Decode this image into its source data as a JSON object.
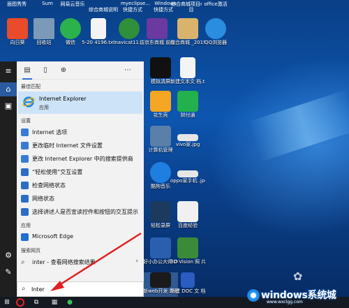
{
  "top_labels": [
    "面图秀秀",
    "Sum",
    "网易云音乐",
    "myeclipse...",
    "Windows",
    "综合商城项目rar",
    "office激活"
  ],
  "top_labels_mid": [
    "综合商城说明",
    "快捷方式",
    "快捷方式",
    "目"
  ],
  "desktop_icons_row1": [
    {
      "label": "向日葵",
      "icon": "sunflower-icon",
      "color": "#e94b2b"
    },
    {
      "label": "回收站",
      "icon": "recycle-bin-icon",
      "color": "#7a9ab8"
    },
    {
      "label": "微信",
      "icon": "wechat-icon",
      "color": "#2bb24c"
    },
    {
      "label": "5-20\n4196.txt",
      "icon": "text-file-icon",
      "color": "#f4f4f4"
    },
    {
      "label": "navicat11...",
      "icon": "navicat-icon",
      "color": "#2f8f3a"
    },
    {
      "label": "仿京东商城\n前台代码",
      "icon": "rar-icon",
      "color": "#6a3aa0"
    },
    {
      "label": "综合商城\n_2019082...",
      "icon": "avatar-icon",
      "color": "#d9b36c"
    },
    {
      "label": "QQ浏览器",
      "icon": "qq-browser-icon",
      "color": "#2a8de0"
    }
  ],
  "desktop_icons_right": [
    {
      "label": "模拟清屏",
      "icon": "cmd-icon",
      "color": "#111111"
    },
    {
      "label": "新建文本文\n档.txt",
      "icon": "text-file-icon",
      "color": "#f4f4f4"
    },
    {
      "label": "花生壳",
      "icon": "peanut-icon",
      "color": "#f5a623"
    },
    {
      "label": "财付通",
      "icon": "tenpay-icon",
      "color": "#22b14c"
    },
    {
      "label": "计算机管理",
      "icon": "computer-mgmt-icon",
      "color": "#5a7fa8"
    },
    {
      "label": "vivo家.jpg",
      "icon": "image-icon",
      "color": "#e6e6e6"
    },
    {
      "label": "酷狗音乐",
      "icon": "kugou-icon",
      "color": "#1f7fe0"
    },
    {
      "label": "oppo家手机\n.jpg",
      "icon": "image-icon",
      "color": "#e6e6e6"
    },
    {
      "label": "轻松录屏",
      "icon": "screen-record-icon",
      "color": "#1b3a5e"
    },
    {
      "label": "百度经验",
      "icon": "baidu-icon",
      "color": "#f0f0f0"
    },
    {
      "label": "好小办公大师\nOfficeBox",
      "icon": "officebox-icon",
      "color": "#2a5fb0"
    },
    {
      "label": "3D Vision 照\n片查看器",
      "icon": "3dvision-icon",
      "color": "#3a8a3a"
    },
    {
      "label": "新web开发\n环境",
      "icon": "terminal-icon",
      "color": "#1a1a1a"
    },
    {
      "label": "新建 DOC 文\n档",
      "icon": "doc-icon",
      "color": "#2b5cbf"
    }
  ],
  "search_panel": {
    "best_match_header": "最佳匹配",
    "best_match_title": "Internet Explorer",
    "best_match_subtitle": "应用",
    "settings_header": "设置",
    "settings_items": [
      {
        "label": "Internet 选项",
        "icon": "internet-options-icon",
        "color": "#3a7bd5"
      },
      {
        "label": "更改临时 Internet 文件设置",
        "icon": "internet-options-icon",
        "color": "#3a7bd5"
      },
      {
        "label": "更改 Internet Explorer 中的搜索提供商",
        "icon": "internet-options-icon",
        "color": "#3a7bd5"
      },
      {
        "label": "“轻松使用”交互设置",
        "icon": "ease-of-access-icon",
        "color": "#2b6cc4"
      },
      {
        "label": "检查网络状态",
        "icon": "network-icon",
        "color": "#2b6cc4"
      },
      {
        "label": "网络状态",
        "icon": "network-icon",
        "color": "#2b6cc4"
      },
      {
        "label": "选择讲述人是否宣读控件和按钮的交互提示",
        "icon": "narrator-icon",
        "color": "#2b6cc4"
      }
    ],
    "apps_header": "应用",
    "apps_items": [
      {
        "label": "Microsoft Edge",
        "icon": "edge-icon",
        "color": "#1f6ed4"
      }
    ],
    "web_header": "搜索网页",
    "web_items": [
      {
        "label": "inter - 查看网络搜索结果",
        "icon": "search-icon"
      }
    ],
    "search_query": "Inter",
    "search_placeholder": ""
  },
  "taskbar": {
    "start_icon": "windows-logo-icon",
    "items": [
      "task-view-icon",
      "store-icon",
      "browser-icon"
    ]
  },
  "watermark": {
    "text": "windows系统城",
    "url": "www.wxclgg.com"
  }
}
